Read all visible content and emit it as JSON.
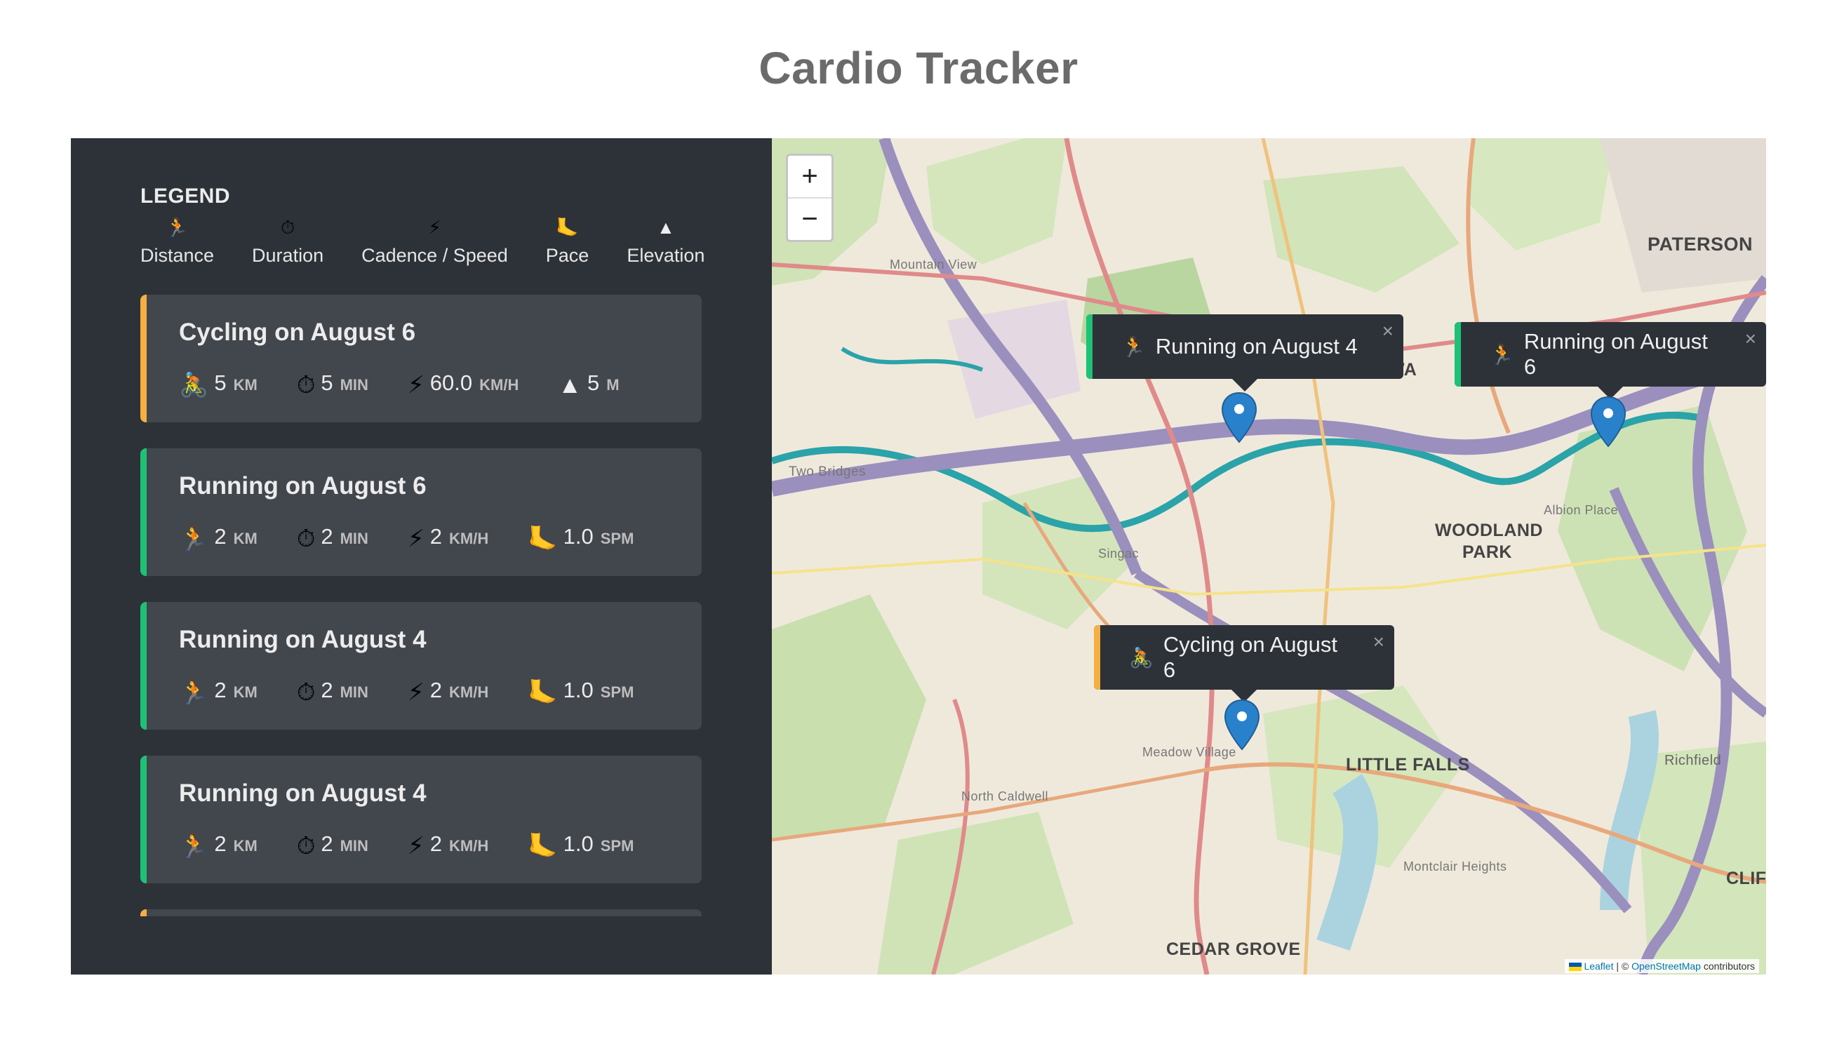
{
  "page_title": "Cardio Tracker",
  "legend": {
    "title": "LEGEND",
    "items": [
      {
        "icon": "🏃",
        "label": "Distance"
      },
      {
        "icon": "⏱",
        "label": "Duration"
      },
      {
        "icon": "⚡",
        "label": "Cadence / Speed"
      },
      {
        "icon": "🦶",
        "label": "Pace"
      },
      {
        "icon": "▲",
        "label": "Elevation"
      }
    ]
  },
  "workouts": [
    {
      "title": "Cycling on August 6",
      "type": "cycling",
      "color": "#f5b041",
      "distance": {
        "icon": "🚴",
        "value": "5",
        "unit": "KM"
      },
      "duration": {
        "icon": "⏱",
        "value": "5",
        "unit": "MIN"
      },
      "speed": {
        "icon": "⚡",
        "value": "60.0",
        "unit": "KM/H"
      },
      "extra": {
        "icon": "▲",
        "value": "5",
        "unit": "M"
      }
    },
    {
      "title": "Running on August 6",
      "type": "running",
      "color": "#1ec276",
      "distance": {
        "icon": "🏃",
        "value": "2",
        "unit": "KM"
      },
      "duration": {
        "icon": "⏱",
        "value": "2",
        "unit": "MIN"
      },
      "speed": {
        "icon": "⚡",
        "value": "2",
        "unit": "KM/H"
      },
      "extra": {
        "icon": "🦶",
        "value": "1.0",
        "unit": "SPM"
      }
    },
    {
      "title": "Running on August 4",
      "type": "running",
      "color": "#1ec276",
      "distance": {
        "icon": "🏃",
        "value": "2",
        "unit": "KM"
      },
      "duration": {
        "icon": "⏱",
        "value": "2",
        "unit": "MIN"
      },
      "speed": {
        "icon": "⚡",
        "value": "2",
        "unit": "KM/H"
      },
      "extra": {
        "icon": "🦶",
        "value": "1.0",
        "unit": "SPM"
      }
    },
    {
      "title": "Running on August 4",
      "type": "running",
      "color": "#1ec276",
      "distance": {
        "icon": "🏃",
        "value": "2",
        "unit": "KM"
      },
      "duration": {
        "icon": "⏱",
        "value": "2",
        "unit": "MIN"
      },
      "speed": {
        "icon": "⚡",
        "value": "2",
        "unit": "KM/H"
      },
      "extra": {
        "icon": "🦶",
        "value": "1.0",
        "unit": "SPM"
      }
    },
    {
      "title": "",
      "type": "cycling",
      "color": "#f5b041",
      "distance": {
        "icon": "",
        "value": "",
        "unit": ""
      },
      "duration": {
        "icon": "",
        "value": "",
        "unit": ""
      },
      "speed": {
        "icon": "",
        "value": "",
        "unit": ""
      },
      "extra": {
        "icon": "",
        "value": "",
        "unit": ""
      }
    }
  ],
  "map": {
    "zoom_in": "+",
    "zoom_out": "−",
    "popups": [
      {
        "icon": "🏃",
        "text": "Running on August 4",
        "color": "#1ec276",
        "close": "×"
      },
      {
        "icon": "🏃",
        "text": "Running on August 6",
        "color": "#1ec276",
        "close": "×"
      },
      {
        "icon": "🚴",
        "text": "Cycling on August 6",
        "color": "#f5b041",
        "close": "×"
      }
    ],
    "places": [
      "PATERSON",
      "WOODLAND",
      "PARK",
      "LITTLE FALLS",
      "CEDAR GROVE",
      "Mountain View",
      "Two Bridges",
      "Richfield",
      "CLIFT",
      "Albion Place",
      "Montclair Heights",
      "North Caldwell",
      "Meadow Village",
      "Singac",
      "WA"
    ],
    "attribution": {
      "leaflet": "Leaflet",
      "sep": " | © ",
      "osm": "OpenStreetMap",
      "tail": " contributors"
    },
    "pin_color": "#2a81cb"
  }
}
